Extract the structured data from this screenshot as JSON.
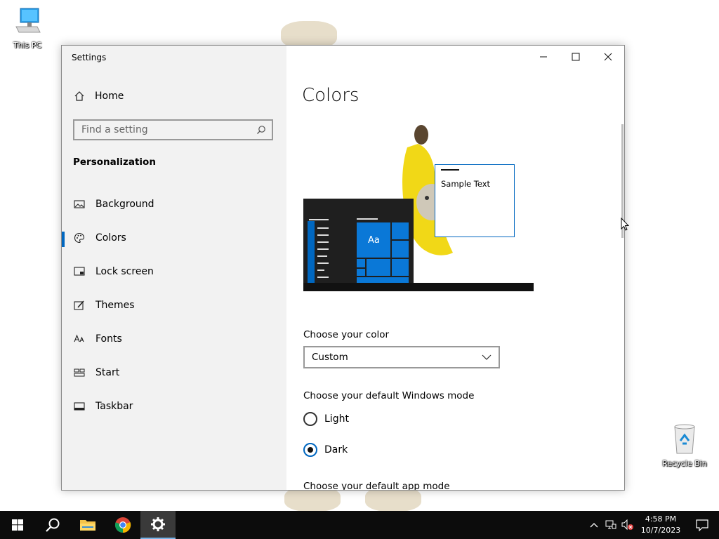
{
  "desktop": {
    "icons": [
      {
        "label": "This PC"
      },
      {
        "label": "Recycle Bin"
      }
    ]
  },
  "window": {
    "title": "Settings",
    "sidebar": {
      "home_label": "Home",
      "search_placeholder": "Find a setting",
      "section_title": "Personalization",
      "items": [
        {
          "label": "Background",
          "icon": "picture-icon"
        },
        {
          "label": "Colors",
          "icon": "palette-icon",
          "active": true
        },
        {
          "label": "Lock screen",
          "icon": "lock-screen-icon"
        },
        {
          "label": "Themes",
          "icon": "brush-icon"
        },
        {
          "label": "Fonts",
          "icon": "fonts-icon"
        },
        {
          "label": "Start",
          "icon": "start-icon"
        },
        {
          "label": "Taskbar",
          "icon": "taskbar-icon"
        }
      ]
    },
    "content": {
      "title": "Colors",
      "preview": {
        "sample_text": "Sample Text",
        "tile_label": "Aa"
      },
      "choose_color_label": "Choose your color",
      "choose_color_value": "Custom",
      "windows_mode_label": "Choose your default Windows mode",
      "modes": [
        {
          "label": "Light",
          "selected": false
        },
        {
          "label": "Dark",
          "selected": true
        }
      ],
      "app_mode_label": "Choose your default app mode"
    }
  },
  "taskbar": {
    "clock_time": "4:58 PM",
    "clock_date": "10/7/2023",
    "accent": "#0067c0"
  }
}
